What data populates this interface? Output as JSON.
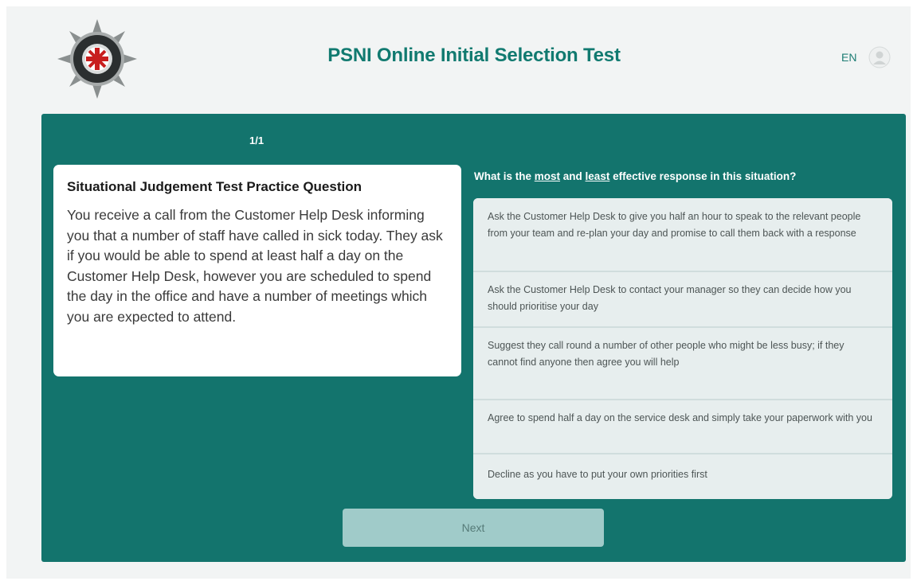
{
  "header": {
    "title": "PSNI Online Initial Selection Test",
    "language": "EN",
    "badge_icon": "psni-crest-icon",
    "user_icon": "user-avatar-icon"
  },
  "colors": {
    "accent": "#117a70",
    "panel": "#13746d",
    "option_bg": "#e7eeee",
    "button_bg": "#a0cbc9"
  },
  "question": {
    "counter": "1/1",
    "title": "Situational Judgement Test Practice Question",
    "body": "You receive a call from the Customer Help Desk informing you that a number of staff have called in sick today. They ask if you would be able to spend at least half a day on the Customer Help Desk, however you are scheduled to spend the day in the office and have a number of meetings which you are expected to attend."
  },
  "prompt": {
    "before": "What is the ",
    "most": "most",
    "middle": " and ",
    "least": "least",
    "after": " effective response in this situation?"
  },
  "options": [
    "Ask the Customer Help Desk to give you half an hour to speak to the relevant people from your team and re-plan your day and promise to call them back with a response",
    "Ask the Customer Help Desk to contact your manager so they can decide how you should prioritise your day",
    "Suggest they call round a number of other people who might be less busy; if they cannot find anyone then agree you will help",
    "Agree to spend half a day on the service desk and simply take your paperwork with you",
    "Decline as you have to put your own priorities first"
  ],
  "actions": {
    "next_label": "Next"
  }
}
